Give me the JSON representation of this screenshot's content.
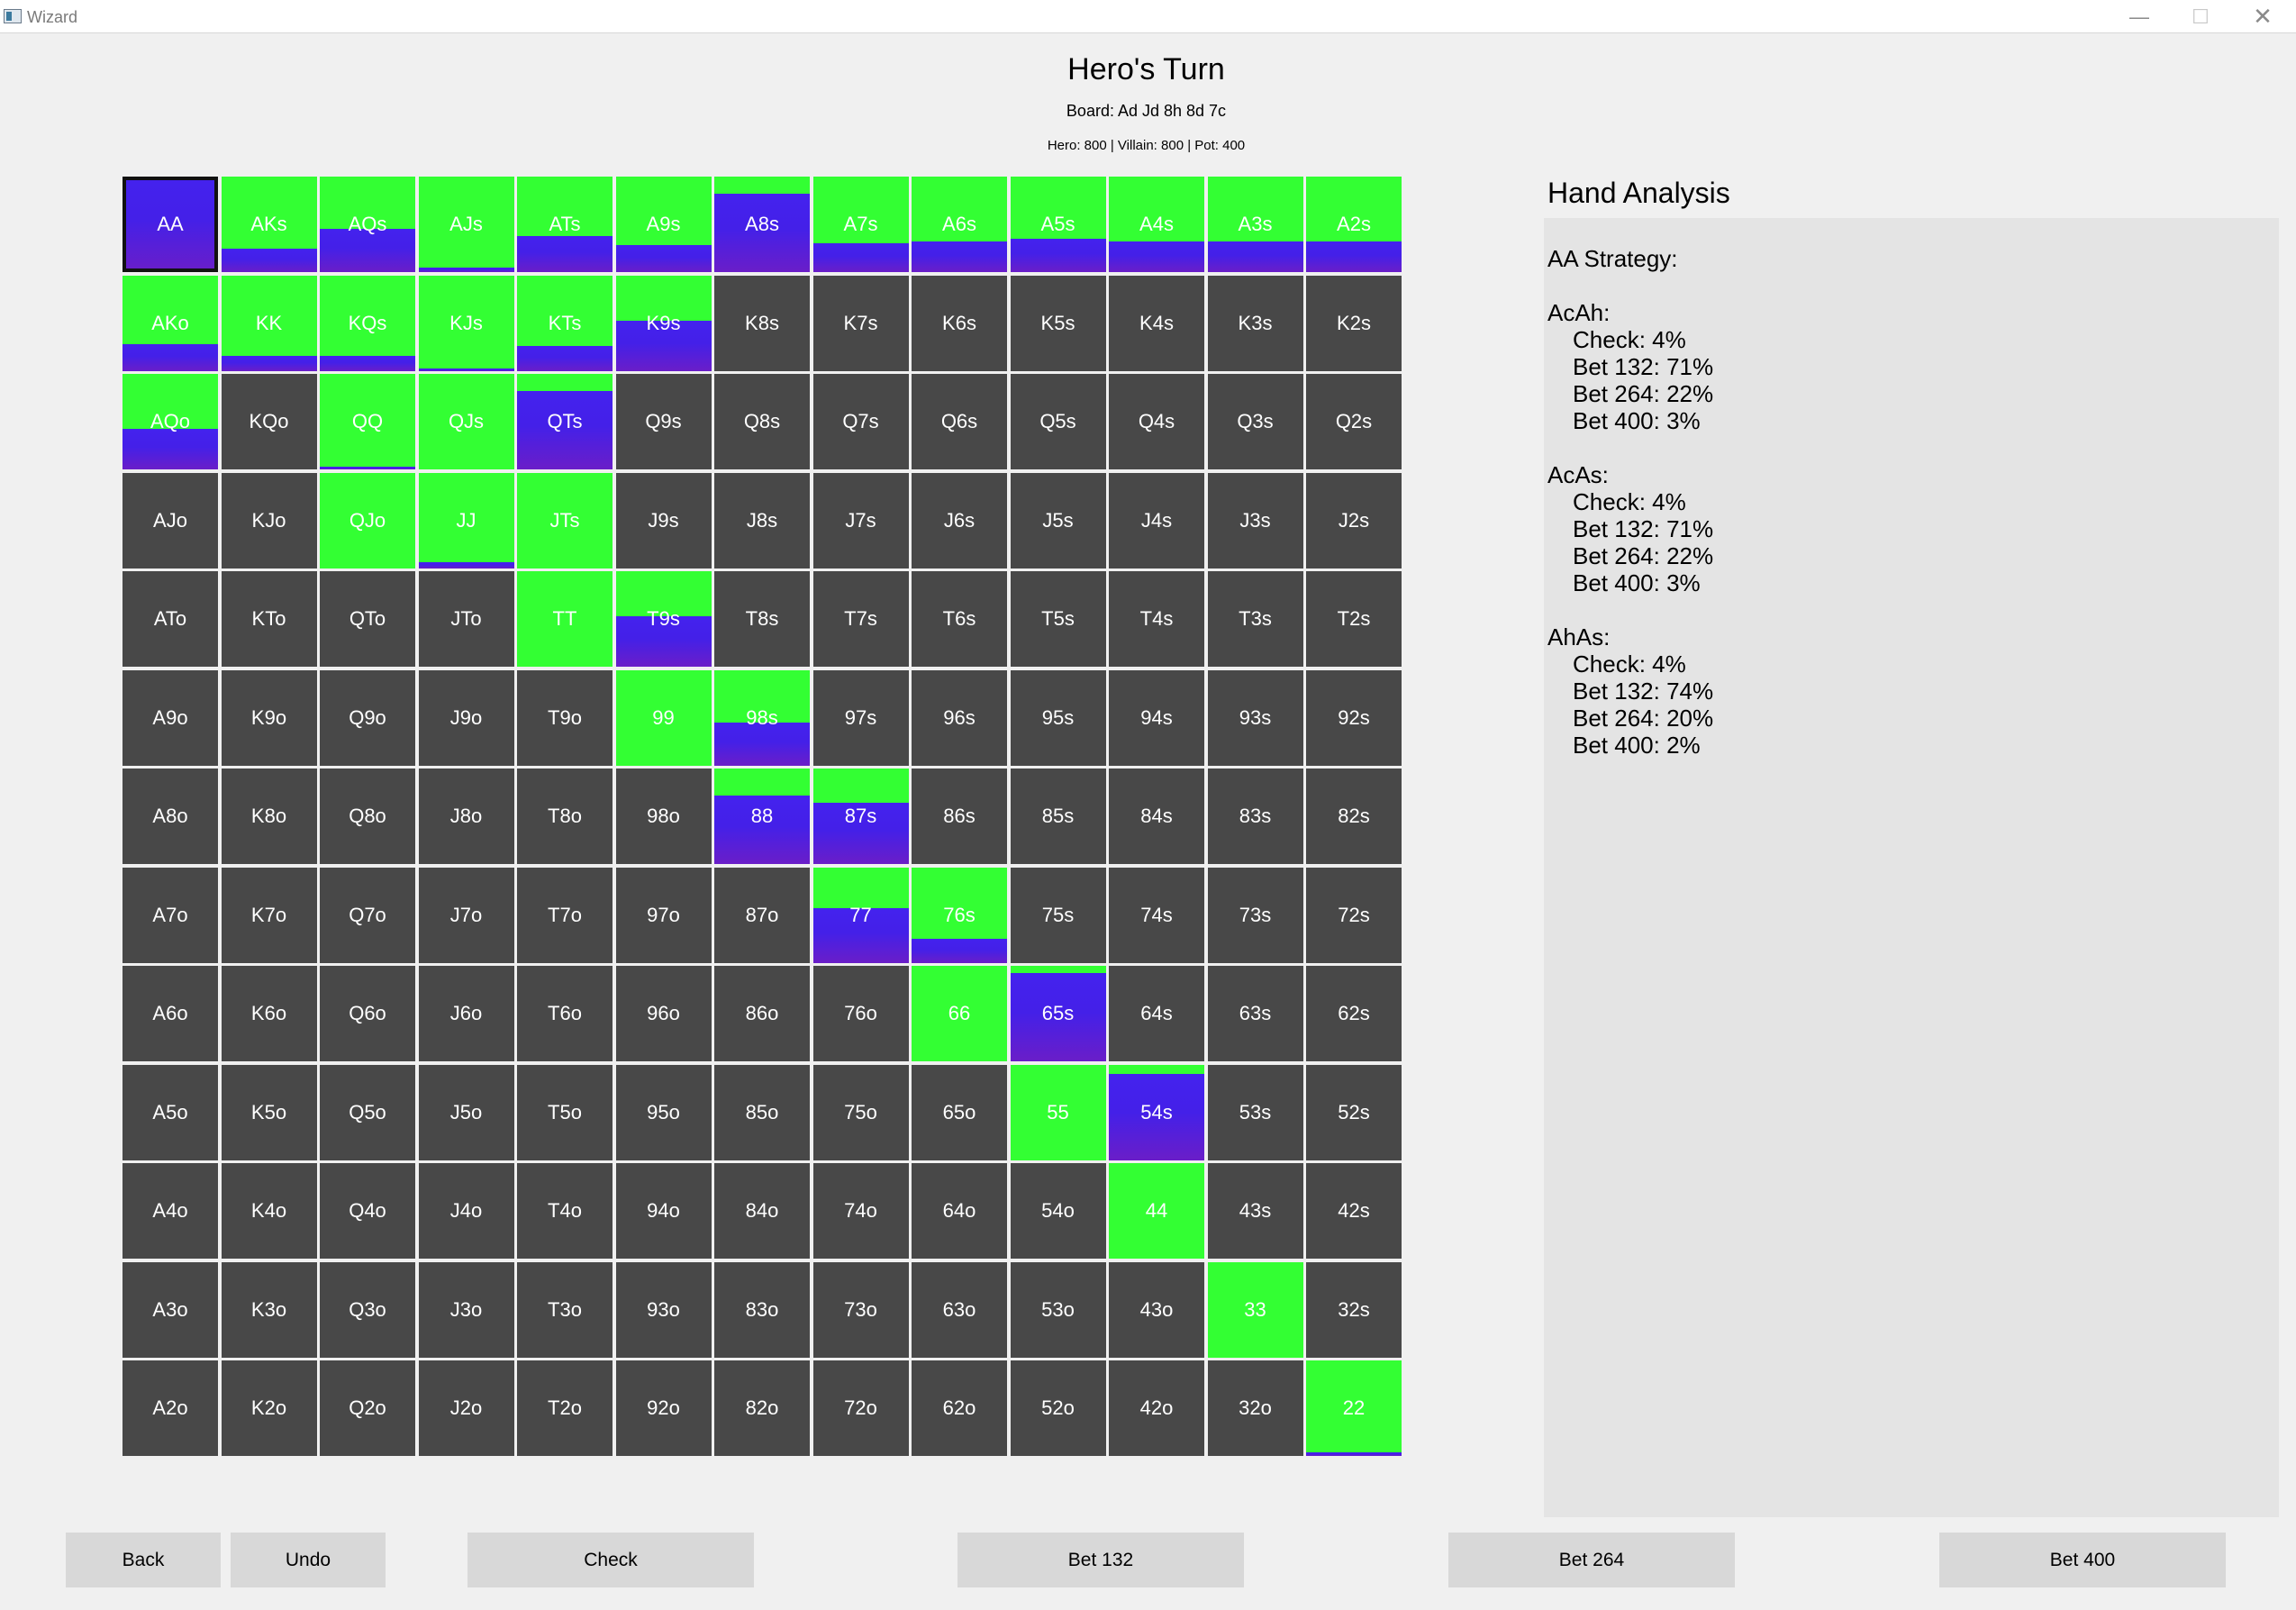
{
  "window": {
    "title": "Wizard"
  },
  "header": {
    "title": "Hero's Turn",
    "board": "Board: Ad Jd 8h 8d 7c",
    "stacks": "Hero: 800 | Villain: 800 | Pot: 400"
  },
  "colors": {
    "cell_bg": "#484848",
    "green": "#33ff33",
    "blue": "#4422ee",
    "purple": "#6a1ec8"
  },
  "grid": {
    "selected": "AA",
    "legend_note": "green = check frequency, blue/purple = bet frequency",
    "rows": [
      [
        {
          "l": "AA",
          "g": 0.0,
          "b": 1.0
        },
        {
          "l": "AKs",
          "g": 0.75,
          "b": 0.25
        },
        {
          "l": "AQs",
          "g": 0.55,
          "b": 0.45
        },
        {
          "l": "AJs",
          "g": 0.95,
          "b": 0.05
        },
        {
          "l": "ATs",
          "g": 0.62,
          "b": 0.38
        },
        {
          "l": "A9s",
          "g": 0.72,
          "b": 0.28
        },
        {
          "l": "A8s",
          "g": 0.18,
          "b": 0.82
        },
        {
          "l": "A7s",
          "g": 0.7,
          "b": 0.3
        },
        {
          "l": "A6s",
          "g": 0.68,
          "b": 0.32
        },
        {
          "l": "A5s",
          "g": 0.65,
          "b": 0.35
        },
        {
          "l": "A4s",
          "g": 0.68,
          "b": 0.32
        },
        {
          "l": "A3s",
          "g": 0.68,
          "b": 0.32
        },
        {
          "l": "A2s",
          "g": 0.68,
          "b": 0.32
        }
      ],
      [
        {
          "l": "AKo",
          "g": 0.72,
          "b": 0.28
        },
        {
          "l": "KK",
          "g": 0.84,
          "b": 0.16
        },
        {
          "l": "KQs",
          "g": 0.84,
          "b": 0.16
        },
        {
          "l": "KJs",
          "g": 0.98,
          "b": 0.02
        },
        {
          "l": "KTs",
          "g": 0.74,
          "b": 0.26
        },
        {
          "l": "K9s",
          "g": 0.48,
          "b": 0.52
        },
        {
          "l": "K8s",
          "g": 0,
          "b": 0
        },
        {
          "l": "K7s",
          "g": 0,
          "b": 0
        },
        {
          "l": "K6s",
          "g": 0,
          "b": 0
        },
        {
          "l": "K5s",
          "g": 0,
          "b": 0
        },
        {
          "l": "K4s",
          "g": 0,
          "b": 0
        },
        {
          "l": "K3s",
          "g": 0,
          "b": 0
        },
        {
          "l": "K2s",
          "g": 0,
          "b": 0
        }
      ],
      [
        {
          "l": "AQo",
          "g": 0.58,
          "b": 0.42
        },
        {
          "l": "KQo",
          "g": 0,
          "b": 0
        },
        {
          "l": "QQ",
          "g": 0.97,
          "b": 0.03
        },
        {
          "l": "QJs",
          "g": 1.0,
          "b": 0.0
        },
        {
          "l": "QTs",
          "g": 0.18,
          "b": 0.82
        },
        {
          "l": "Q9s",
          "g": 0,
          "b": 0
        },
        {
          "l": "Q8s",
          "g": 0,
          "b": 0
        },
        {
          "l": "Q7s",
          "g": 0,
          "b": 0
        },
        {
          "l": "Q6s",
          "g": 0,
          "b": 0
        },
        {
          "l": "Q5s",
          "g": 0,
          "b": 0
        },
        {
          "l": "Q4s",
          "g": 0,
          "b": 0
        },
        {
          "l": "Q3s",
          "g": 0,
          "b": 0
        },
        {
          "l": "Q2s",
          "g": 0,
          "b": 0
        }
      ],
      [
        {
          "l": "AJo",
          "g": 0,
          "b": 0
        },
        {
          "l": "KJo",
          "g": 0,
          "b": 0
        },
        {
          "l": "QJo",
          "g": 1.0,
          "b": 0.0
        },
        {
          "l": "JJ",
          "g": 0.94,
          "b": 0.06
        },
        {
          "l": "JTs",
          "g": 1.0,
          "b": 0.0
        },
        {
          "l": "J9s",
          "g": 0,
          "b": 0
        },
        {
          "l": "J8s",
          "g": 0,
          "b": 0
        },
        {
          "l": "J7s",
          "g": 0,
          "b": 0
        },
        {
          "l": "J6s",
          "g": 0,
          "b": 0
        },
        {
          "l": "J5s",
          "g": 0,
          "b": 0
        },
        {
          "l": "J4s",
          "g": 0,
          "b": 0
        },
        {
          "l": "J3s",
          "g": 0,
          "b": 0
        },
        {
          "l": "J2s",
          "g": 0,
          "b": 0
        }
      ],
      [
        {
          "l": "ATo",
          "g": 0,
          "b": 0
        },
        {
          "l": "KTo",
          "g": 0,
          "b": 0
        },
        {
          "l": "QTo",
          "g": 0,
          "b": 0
        },
        {
          "l": "JTo",
          "g": 0,
          "b": 0
        },
        {
          "l": "TT",
          "g": 1.0,
          "b": 0.0
        },
        {
          "l": "T9s",
          "g": 0.47,
          "b": 0.53
        },
        {
          "l": "T8s",
          "g": 0,
          "b": 0
        },
        {
          "l": "T7s",
          "g": 0,
          "b": 0
        },
        {
          "l": "T6s",
          "g": 0,
          "b": 0
        },
        {
          "l": "T5s",
          "g": 0,
          "b": 0
        },
        {
          "l": "T4s",
          "g": 0,
          "b": 0
        },
        {
          "l": "T3s",
          "g": 0,
          "b": 0
        },
        {
          "l": "T2s",
          "g": 0,
          "b": 0
        }
      ],
      [
        {
          "l": "A9o",
          "g": 0,
          "b": 0
        },
        {
          "l": "K9o",
          "g": 0,
          "b": 0
        },
        {
          "l": "Q9o",
          "g": 0,
          "b": 0
        },
        {
          "l": "J9o",
          "g": 0,
          "b": 0
        },
        {
          "l": "T9o",
          "g": 0,
          "b": 0
        },
        {
          "l": "99",
          "g": 1.0,
          "b": 0.0
        },
        {
          "l": "98s",
          "g": 0.55,
          "b": 0.45
        },
        {
          "l": "97s",
          "g": 0,
          "b": 0
        },
        {
          "l": "96s",
          "g": 0,
          "b": 0
        },
        {
          "l": "95s",
          "g": 0,
          "b": 0
        },
        {
          "l": "94s",
          "g": 0,
          "b": 0
        },
        {
          "l": "93s",
          "g": 0,
          "b": 0
        },
        {
          "l": "92s",
          "g": 0,
          "b": 0
        }
      ],
      [
        {
          "l": "A8o",
          "g": 0,
          "b": 0
        },
        {
          "l": "K8o",
          "g": 0,
          "b": 0
        },
        {
          "l": "Q8o",
          "g": 0,
          "b": 0
        },
        {
          "l": "J8o",
          "g": 0,
          "b": 0
        },
        {
          "l": "T8o",
          "g": 0,
          "b": 0
        },
        {
          "l": "98o",
          "g": 0,
          "b": 0
        },
        {
          "l": "88",
          "g": 0.28,
          "b": 0.72
        },
        {
          "l": "87s",
          "g": 0.36,
          "b": 0.64
        },
        {
          "l": "86s",
          "g": 0,
          "b": 0
        },
        {
          "l": "85s",
          "g": 0,
          "b": 0
        },
        {
          "l": "84s",
          "g": 0,
          "b": 0
        },
        {
          "l": "83s",
          "g": 0,
          "b": 0
        },
        {
          "l": "82s",
          "g": 0,
          "b": 0
        }
      ],
      [
        {
          "l": "A7o",
          "g": 0,
          "b": 0
        },
        {
          "l": "K7o",
          "g": 0,
          "b": 0
        },
        {
          "l": "Q7o",
          "g": 0,
          "b": 0
        },
        {
          "l": "J7o",
          "g": 0,
          "b": 0
        },
        {
          "l": "T7o",
          "g": 0,
          "b": 0
        },
        {
          "l": "97o",
          "g": 0,
          "b": 0
        },
        {
          "l": "87o",
          "g": 0,
          "b": 0
        },
        {
          "l": "77",
          "g": 0.43,
          "b": 0.57
        },
        {
          "l": "76s",
          "g": 0.75,
          "b": 0.25
        },
        {
          "l": "75s",
          "g": 0,
          "b": 0
        },
        {
          "l": "74s",
          "g": 0,
          "b": 0
        },
        {
          "l": "73s",
          "g": 0,
          "b": 0
        },
        {
          "l": "72s",
          "g": 0,
          "b": 0
        }
      ],
      [
        {
          "l": "A6o",
          "g": 0,
          "b": 0
        },
        {
          "l": "K6o",
          "g": 0,
          "b": 0
        },
        {
          "l": "Q6o",
          "g": 0,
          "b": 0
        },
        {
          "l": "J6o",
          "g": 0,
          "b": 0
        },
        {
          "l": "T6o",
          "g": 0,
          "b": 0
        },
        {
          "l": "96o",
          "g": 0,
          "b": 0
        },
        {
          "l": "86o",
          "g": 0,
          "b": 0
        },
        {
          "l": "76o",
          "g": 0,
          "b": 0
        },
        {
          "l": "66",
          "g": 1.0,
          "b": 0.0
        },
        {
          "l": "65s",
          "g": 0.08,
          "b": 0.92
        },
        {
          "l": "64s",
          "g": 0,
          "b": 0
        },
        {
          "l": "63s",
          "g": 0,
          "b": 0
        },
        {
          "l": "62s",
          "g": 0,
          "b": 0
        }
      ],
      [
        {
          "l": "A5o",
          "g": 0,
          "b": 0
        },
        {
          "l": "K5o",
          "g": 0,
          "b": 0
        },
        {
          "l": "Q5o",
          "g": 0,
          "b": 0
        },
        {
          "l": "J5o",
          "g": 0,
          "b": 0
        },
        {
          "l": "T5o",
          "g": 0,
          "b": 0
        },
        {
          "l": "95o",
          "g": 0,
          "b": 0
        },
        {
          "l": "85o",
          "g": 0,
          "b": 0
        },
        {
          "l": "75o",
          "g": 0,
          "b": 0
        },
        {
          "l": "65o",
          "g": 0,
          "b": 0
        },
        {
          "l": "55",
          "g": 1.0,
          "b": 0.0
        },
        {
          "l": "54s",
          "g": 0.1,
          "b": 0.9
        },
        {
          "l": "53s",
          "g": 0,
          "b": 0
        },
        {
          "l": "52s",
          "g": 0,
          "b": 0
        }
      ],
      [
        {
          "l": "A4o",
          "g": 0,
          "b": 0
        },
        {
          "l": "K4o",
          "g": 0,
          "b": 0
        },
        {
          "l": "Q4o",
          "g": 0,
          "b": 0
        },
        {
          "l": "J4o",
          "g": 0,
          "b": 0
        },
        {
          "l": "T4o",
          "g": 0,
          "b": 0
        },
        {
          "l": "94o",
          "g": 0,
          "b": 0
        },
        {
          "l": "84o",
          "g": 0,
          "b": 0
        },
        {
          "l": "74o",
          "g": 0,
          "b": 0
        },
        {
          "l": "64o",
          "g": 0,
          "b": 0
        },
        {
          "l": "54o",
          "g": 0,
          "b": 0
        },
        {
          "l": "44",
          "g": 1.0,
          "b": 0.0
        },
        {
          "l": "43s",
          "g": 0,
          "b": 0
        },
        {
          "l": "42s",
          "g": 0,
          "b": 0
        }
      ],
      [
        {
          "l": "A3o",
          "g": 0,
          "b": 0
        },
        {
          "l": "K3o",
          "g": 0,
          "b": 0
        },
        {
          "l": "Q3o",
          "g": 0,
          "b": 0
        },
        {
          "l": "J3o",
          "g": 0,
          "b": 0
        },
        {
          "l": "T3o",
          "g": 0,
          "b": 0
        },
        {
          "l": "93o",
          "g": 0,
          "b": 0
        },
        {
          "l": "83o",
          "g": 0,
          "b": 0
        },
        {
          "l": "73o",
          "g": 0,
          "b": 0
        },
        {
          "l": "63o",
          "g": 0,
          "b": 0
        },
        {
          "l": "53o",
          "g": 0,
          "b": 0
        },
        {
          "l": "43o",
          "g": 0,
          "b": 0
        },
        {
          "l": "33",
          "g": 1.0,
          "b": 0.0
        },
        {
          "l": "32s",
          "g": 0,
          "b": 0
        }
      ],
      [
        {
          "l": "A2o",
          "g": 0,
          "b": 0
        },
        {
          "l": "K2o",
          "g": 0,
          "b": 0
        },
        {
          "l": "Q2o",
          "g": 0,
          "b": 0
        },
        {
          "l": "J2o",
          "g": 0,
          "b": 0
        },
        {
          "l": "T2o",
          "g": 0,
          "b": 0
        },
        {
          "l": "92o",
          "g": 0,
          "b": 0
        },
        {
          "l": "82o",
          "g": 0,
          "b": 0
        },
        {
          "l": "72o",
          "g": 0,
          "b": 0
        },
        {
          "l": "62o",
          "g": 0,
          "b": 0
        },
        {
          "l": "52o",
          "g": 0,
          "b": 0
        },
        {
          "l": "42o",
          "g": 0,
          "b": 0
        },
        {
          "l": "32o",
          "g": 0,
          "b": 0
        },
        {
          "l": "22",
          "g": 0.96,
          "b": 0.04
        }
      ]
    ]
  },
  "analysis": {
    "title": "Hand Analysis",
    "strategy_header": "AA Strategy:",
    "combos": [
      {
        "name": "AcAh:",
        "lines": [
          "Check: 4%",
          "Bet 132: 71%",
          "Bet 264: 22%",
          "Bet 400: 3%"
        ]
      },
      {
        "name": "AcAs:",
        "lines": [
          "Check: 4%",
          "Bet 132: 71%",
          "Bet 264: 22%",
          "Bet 400: 3%"
        ]
      },
      {
        "name": "AhAs:",
        "lines": [
          "Check: 4%",
          "Bet 132: 74%",
          "Bet 264: 20%",
          "Bet 400: 2%"
        ]
      }
    ]
  },
  "actions": {
    "back": "Back",
    "undo": "Undo",
    "check": "Check",
    "bet1": "Bet 132",
    "bet2": "Bet 264",
    "bet3": "Bet 400"
  }
}
